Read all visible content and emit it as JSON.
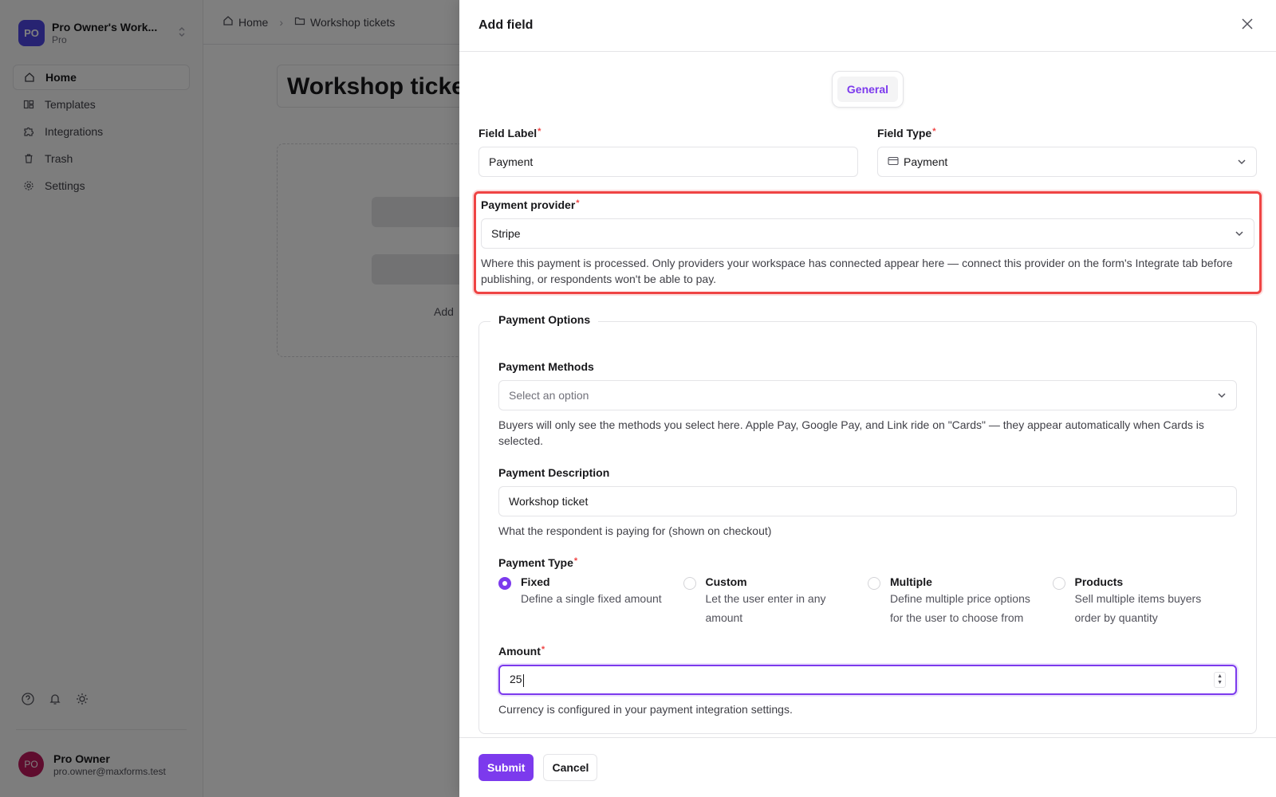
{
  "workspace": {
    "initials": "PO",
    "name": "Pro Owner's Work...",
    "plan": "Pro"
  },
  "nav": {
    "items": [
      {
        "label": "Home",
        "icon": "home-icon"
      },
      {
        "label": "Templates",
        "icon": "templates-icon"
      },
      {
        "label": "Integrations",
        "icon": "puzzle-icon"
      },
      {
        "label": "Trash",
        "icon": "trash-icon"
      },
      {
        "label": "Settings",
        "icon": "gear-icon"
      }
    ]
  },
  "user": {
    "initials": "PO",
    "name": "Pro Owner",
    "email": "pro.owner@maxforms.test"
  },
  "breadcrumb": {
    "home": "Home",
    "current": "Workshop tickets"
  },
  "form": {
    "title": "Workshop tickets",
    "add_text": "Add"
  },
  "drawer": {
    "title": "Add field",
    "tab": "General",
    "field_label": {
      "label": "Field Label",
      "value": "Payment"
    },
    "field_type": {
      "label": "Field Type",
      "value": "Payment"
    },
    "payment_provider": {
      "label": "Payment provider",
      "value": "Stripe",
      "help": "Where this payment is processed. Only providers your workspace has connected appear here — connect this provider on the form's Integrate tab before publishing, or respondents won't be able to pay."
    },
    "payment_options": {
      "legend": "Payment Options",
      "methods": {
        "label": "Payment Methods",
        "placeholder": "Select an option",
        "help": "Buyers will only see the methods you select here. Apple Pay, Google Pay, and Link ride on \"Cards\" — they appear automatically when Cards is selected."
      },
      "description": {
        "label": "Payment Description",
        "value": "Workshop ticket",
        "help": "What the respondent is paying for (shown on checkout)"
      },
      "type": {
        "label": "Payment Type",
        "options": [
          {
            "title": "Fixed",
            "desc": "Define a single fixed amount",
            "selected": true
          },
          {
            "title": "Custom",
            "desc": "Let the user enter in any amount",
            "selected": false
          },
          {
            "title": "Multiple",
            "desc": "Define multiple price options for the user to choose from",
            "selected": false
          },
          {
            "title": "Products",
            "desc": "Sell multiple items buyers order by quantity",
            "selected": false
          }
        ]
      },
      "amount": {
        "label": "Amount",
        "value": "25",
        "help": "Currency is configured in your payment integration settings."
      }
    },
    "footer": {
      "submit": "Submit",
      "cancel": "Cancel"
    }
  },
  "colors": {
    "accent": "#7c3aed",
    "highlight": "#ef4444",
    "required": "#ef4444"
  }
}
